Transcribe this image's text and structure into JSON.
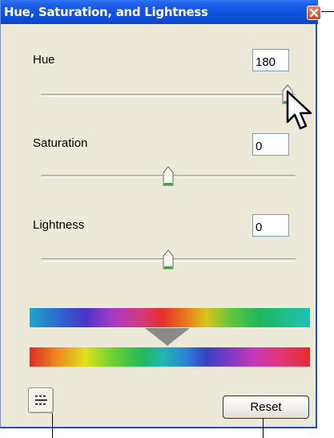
{
  "window": {
    "title": "Hue, Saturation, and Lightness",
    "close_icon": "close-x-icon"
  },
  "controls": {
    "hue": {
      "label": "Hue",
      "value": "180",
      "slider_fraction": 0.97
    },
    "saturation": {
      "label": "Saturation",
      "value": "0",
      "slider_fraction": 0.5
    },
    "lightness": {
      "label": "Lightness",
      "value": "0",
      "slider_fraction": 0.5
    }
  },
  "spectrum": {
    "top_bar": "shifted-hue-spectrum",
    "indicator_icon": "down-triangle-icon",
    "bottom_bar": "original-hue-spectrum"
  },
  "buttons": {
    "mode_icon": "view-toggle-icon",
    "reset_label": "Reset"
  },
  "colors": {
    "titlebar": "#0b52dc",
    "dialog_bg": "#ece9d8",
    "thumb_accent": "#3aa83a"
  }
}
